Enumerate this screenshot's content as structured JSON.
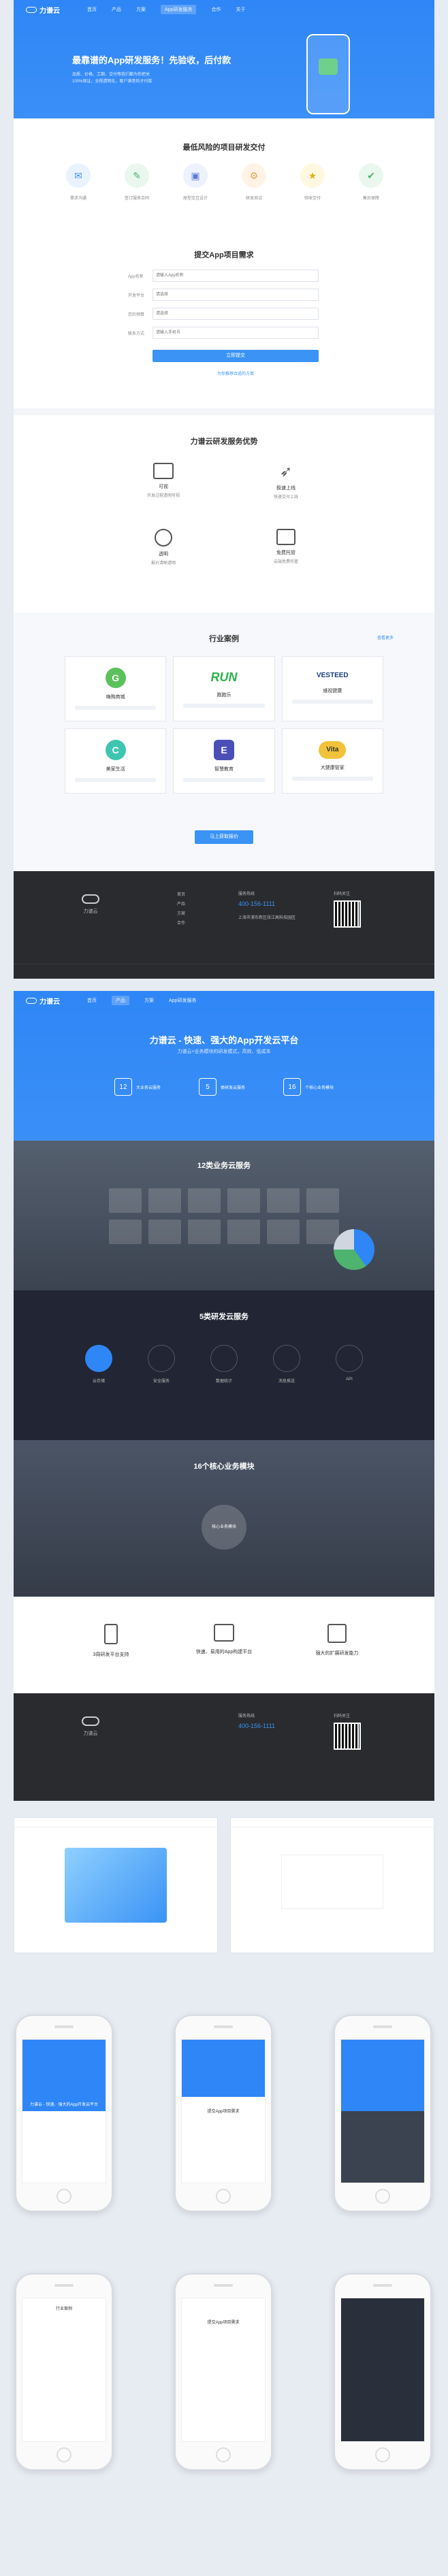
{
  "brand": "力谱云",
  "nav": [
    "首页",
    "产品",
    "方案",
    "App研发服务",
    "合作",
    "关于"
  ],
  "hero": {
    "title": "最靠谱的App研发服务！先验收，后付款",
    "lines": [
      "品质、价格、工期、交付等我们都为你把关",
      "100%保证，全程透明化，客户满意后才付款"
    ]
  },
  "delivery": {
    "title": "最低风险的项目研发交付",
    "steps": [
      "需求沟通",
      "签订服务合同",
      "原型交互设计",
      "研发测试",
      "验收交付",
      "售后保障"
    ]
  },
  "form": {
    "title": "提交App项目需求",
    "fields": [
      "App名称",
      "开发平台",
      "您的预算",
      "联系方式"
    ],
    "placeholders": [
      "请输入App名称",
      "请选择",
      "请选择",
      "请输入手机号"
    ],
    "submit": "立即提交",
    "link": "为你推荐合适的方案"
  },
  "advantages": {
    "title": "力谱云研发服务优势",
    "items": [
      {
        "name": "可视",
        "desc": "开发过程透明可视"
      },
      {
        "name": "极速上线",
        "desc": "快速交付上线"
      },
      {
        "name": "透明",
        "desc": "报价清晰透明"
      },
      {
        "name": "免费托管",
        "desc": "云端免费托管"
      }
    ]
  },
  "cases": {
    "title": "行业案例",
    "more": "查看更多",
    "items": [
      {
        "name": "嗨购商城",
        "logo": "G"
      },
      {
        "name": "跑跑乐",
        "logo": "RUN"
      },
      {
        "name": "维视健康",
        "logo": "VESTEED"
      },
      {
        "name": "美家生活",
        "logo": "C"
      },
      {
        "name": "智慧教育",
        "logo": "E"
      },
      {
        "name": "大健康管家",
        "logo": "Vita"
      }
    ],
    "button": "马上获取报价"
  },
  "footer": {
    "hotline_label": "服务热线",
    "hotline": "400-156-1111",
    "address": "上海市浦东新区张江高科技园区",
    "qr_label": "扫码关注"
  },
  "hero2": {
    "title": "力谱云 - 快速、强大的App开发云平台",
    "sub": "力谱云+业务模块的研发模式，高效、低成本",
    "stats": [
      {
        "n": "12",
        "t": "大业务云服务"
      },
      {
        "n": "5",
        "t": "类研发云服务"
      },
      {
        "n": "16",
        "t": "个核心业务模块"
      }
    ]
  },
  "cloud12": {
    "title": "12类业务云服务"
  },
  "cloud5": {
    "title": "5类研发云服务",
    "items": [
      "云存储",
      "安全服务",
      "数据统计",
      "消息推送",
      "API"
    ]
  },
  "modules": {
    "title": "16个核心业务模块",
    "center": "核心业务模块"
  },
  "features": {
    "items": [
      "3周研发平台支持",
      "快速、易用的App构建平台",
      "强大的扩展研发能力"
    ]
  },
  "mobile": {
    "title": "力谱云 - 快速、强大的App开发云平台",
    "submit": "提交App项目需求",
    "cases": "行业案例",
    "phone_title": "提交App项目需求"
  },
  "colors": {
    "accent": "#3a93f5",
    "dark": "#2a2b2f"
  }
}
